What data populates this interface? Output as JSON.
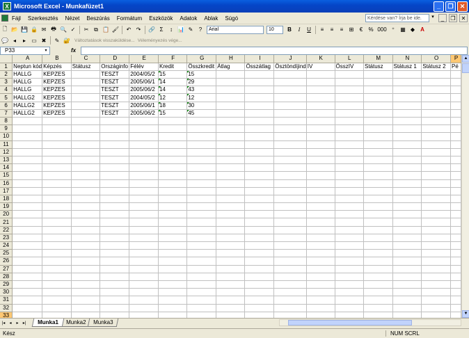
{
  "window": {
    "title": "Microsoft Excel - Munkafüzet1"
  },
  "menu": {
    "items": [
      "Fájl",
      "Szerkesztés",
      "Nézet",
      "Beszúrás",
      "Formátum",
      "Eszközök",
      "Adatok",
      "Ablak",
      "Súgó"
    ],
    "help_placeholder": "Kérdése van? Írja be ide."
  },
  "toolbar": {
    "font_name": "Arial",
    "font_size": "10",
    "zoom": "%",
    "percent_label": "%",
    "thousands_label": "000"
  },
  "toolbar2": {
    "reply_changes": "Változtatások visszaküldése...",
    "end_review": "Véleményezés vége..."
  },
  "formula_bar": {
    "name_box": "P33",
    "fx_label": "fx",
    "formula": ""
  },
  "grid": {
    "columns": [
      "A",
      "B",
      "C",
      "D",
      "E",
      "F",
      "G",
      "H",
      "I",
      "J",
      "K",
      "L",
      "M",
      "N",
      "O",
      "P"
    ],
    "rows": [
      [
        "Neptun kód",
        "Képzés",
        "Státusz",
        "Országinfo",
        "Félév",
        "Kredit",
        "Összkredit",
        "Átlag",
        "Összátlag",
        "Ösztöndíjind",
        "IV",
        "ÖsszIV",
        "Státusz",
        "Státusz 1",
        "Státusz 2",
        "Pé"
      ],
      [
        "HALLG",
        "KEPZES",
        "",
        "TESZT",
        "2004/05/2",
        "15",
        "15",
        "",
        "",
        "",
        "",
        "",
        "",
        "",
        "",
        ""
      ],
      [
        "HALLG",
        "KEPZES",
        "",
        "TESZT",
        "2005/06/1",
        "14",
        "29",
        "",
        "",
        "",
        "",
        "",
        "",
        "",
        "",
        ""
      ],
      [
        "HALLG",
        "KEPZES",
        "",
        "TESZT",
        "2005/06/2",
        "14",
        "43",
        "",
        "",
        "",
        "",
        "",
        "",
        "",
        "",
        ""
      ],
      [
        "HALLG2",
        "KEPZES",
        "",
        "TESZT",
        "2004/05/2",
        "12",
        "12",
        "",
        "",
        "",
        "",
        "",
        "",
        "",
        "",
        ""
      ],
      [
        "HALLG2",
        "KEPZES",
        "",
        "TESZT",
        "2005/06/1",
        "18",
        "30",
        "",
        "",
        "",
        "",
        "",
        "",
        "",
        "",
        ""
      ],
      [
        "HALLG2",
        "KEPZES",
        "",
        "TESZT",
        "2005/06/2",
        "15",
        "45",
        "",
        "",
        "",
        "",
        "",
        "",
        "",
        "",
        ""
      ]
    ],
    "row_count": 33
  },
  "sheet_tabs": [
    "Munka1",
    "Munka2",
    "Munka3"
  ],
  "status": {
    "left": "Kész",
    "right": "NUM SCRL"
  }
}
